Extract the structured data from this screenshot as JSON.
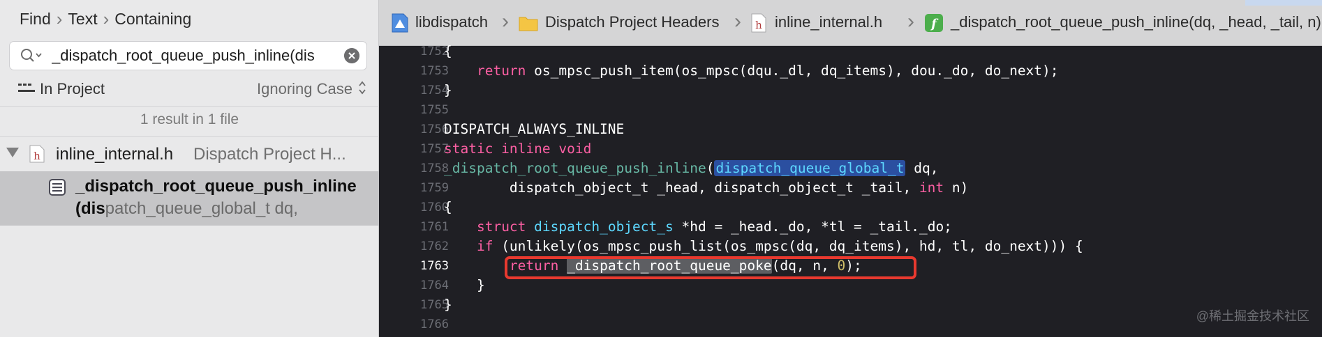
{
  "navigator": {
    "breadcrumb": [
      "Find",
      "Text",
      "Containing"
    ],
    "search": {
      "value": "_dispatch_root_queue_push_inline(dis"
    },
    "scope": {
      "label": "In Project",
      "case_mode": "Ignoring Case"
    },
    "result_summary": "1 result in 1 file",
    "file_result": {
      "name": "inline_internal.h",
      "path": "Dispatch Project H..."
    },
    "match": {
      "bold_part": "_dispatch_root_queue_push_inline(dis",
      "rest_part": "patch_queue_global_t dq,"
    }
  },
  "jump_bar": {
    "items": [
      {
        "label": "libdispatch",
        "icon": "project-icon"
      },
      {
        "label": "Dispatch Project Headers",
        "icon": "folder-icon"
      },
      {
        "label": "inline_internal.h",
        "icon": "header-file-icon"
      },
      {
        "label": "_dispatch_root_queue_push_inline(dq, _head, _tail, n)",
        "icon": "function-icon"
      }
    ]
  },
  "editor": {
    "lines": [
      {
        "num": "1752",
        "text": "{"
      },
      {
        "num": "1753",
        "text": "    return os_mpsc_push_item(os_mpsc(dqu._dl, dq_items), dou._do, do_next);"
      },
      {
        "num": "1754",
        "text": "}"
      },
      {
        "num": "1755",
        "text": ""
      },
      {
        "num": "1756",
        "text": "DISPATCH_ALWAYS_INLINE"
      },
      {
        "num": "1757",
        "text": "static inline void"
      },
      {
        "num": "1758",
        "text": "_dispatch_root_queue_push_inline(dispatch_queue_global_t dq,"
      },
      {
        "num": "1759",
        "text": "        dispatch_object_t _head, dispatch_object_t _tail, int n)"
      },
      {
        "num": "1760",
        "text": "{"
      },
      {
        "num": "1761",
        "text": "    struct dispatch_object_s *hd = _head._do, *tl = _tail._do;"
      },
      {
        "num": "1762",
        "text": "    if (unlikely(os_mpsc_push_list(os_mpsc(dq, dq_items), hd, tl, do_next))) {"
      },
      {
        "num": "1763",
        "text": "        return _dispatch_root_queue_poke(dq, n, 0);"
      },
      {
        "num": "1764",
        "text": "    }"
      },
      {
        "num": "1765",
        "text": "}"
      },
      {
        "num": "1766",
        "text": ""
      }
    ],
    "current_line": "1763"
  },
  "watermark": "@稀土掘金技术社区",
  "colors": {
    "keyword": "#fc5fa3",
    "type": "#5dd8ff",
    "function": "#67b7a4",
    "number": "#d0bf69",
    "highlight_box": "#e8392f"
  }
}
